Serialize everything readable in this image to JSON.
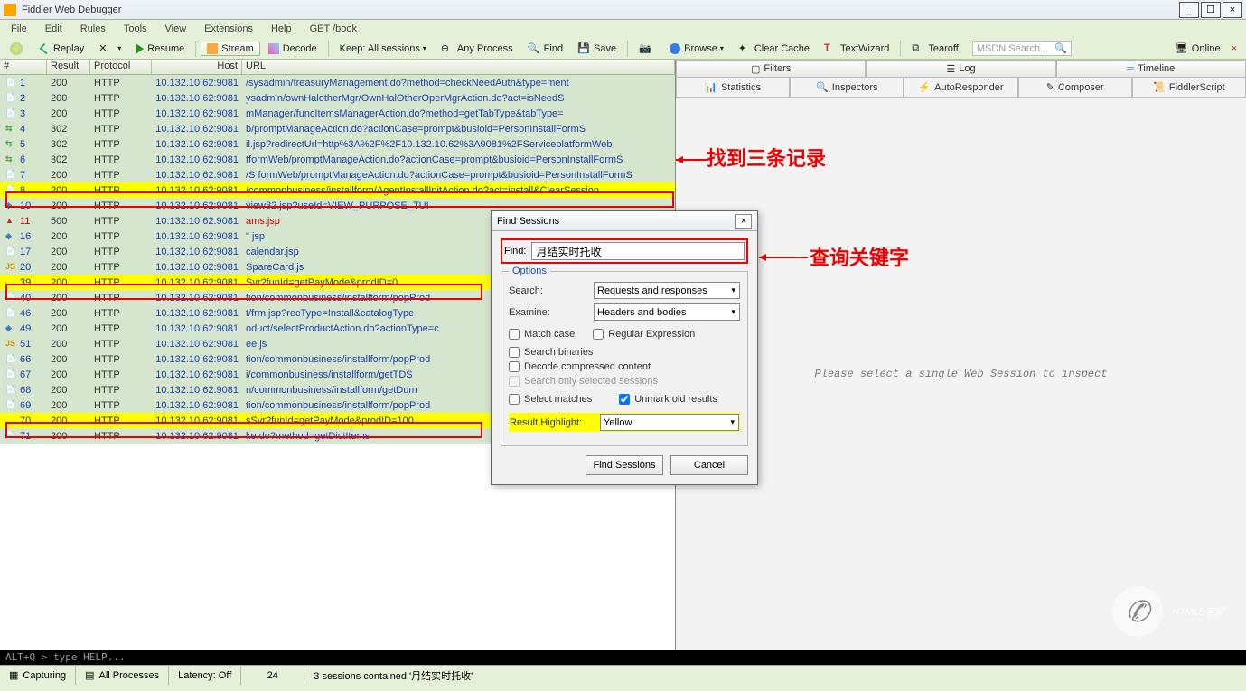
{
  "app": {
    "title": "Fiddler Web Debugger"
  },
  "menu": [
    "File",
    "Edit",
    "Rules",
    "Tools",
    "View",
    "Extensions",
    "Help",
    "GET /book"
  ],
  "toolbar": {
    "replay": "Replay",
    "resume": "Resume",
    "stream": "Stream",
    "decode": "Decode",
    "keep": "Keep: All sessions",
    "anyprocess": "Any Process",
    "find": "Find",
    "save": "Save",
    "browse": "Browse",
    "clearcache": "Clear Cache",
    "textwizard": "TextWizard",
    "tearoff": "Tearoff",
    "search_placeholder": "MSDN Search...",
    "online": "Online"
  },
  "columns": {
    "num": "#",
    "result": "Result",
    "protocol": "Protocol",
    "host": "Host",
    "url": "URL"
  },
  "sessions": [
    {
      "n": "1",
      "res": "200",
      "proto": "HTTP",
      "host": "10.132.10.62:9081",
      "url": "/sysadmin/treasuryManagement.do?method=checkNeedAuth&type=ment",
      "ic": "doc",
      "cls": "normal"
    },
    {
      "n": "2",
      "res": "200",
      "proto": "HTTP",
      "host": "10.132.10.62:9081",
      "url": "ysadmin/ownHalotherMgr/OwnHalOtherOperMgrAction.do?act=isNeedS",
      "ic": "doc",
      "cls": "normal"
    },
    {
      "n": "3",
      "res": "200",
      "proto": "HTTP",
      "host": "10.132.10.62:9081",
      "url": "mManager/funcItemsManagerAction.do?method=getTabType&tabType=",
      "ic": "doc",
      "cls": "normal"
    },
    {
      "n": "4",
      "res": "302",
      "proto": "HTTP",
      "host": "10.132.10.62:9081",
      "url": "b/promptManageAction.do?actionCase=prompt&busioid=PersonInstallFormS",
      "ic": "redir",
      "cls": "normal"
    },
    {
      "n": "5",
      "res": "302",
      "proto": "HTTP",
      "host": "10.132.10.62:9081",
      "url": "il.jsp?redirectUrl=http%3A%2F%2F10.132.10.62%3A9081%2FServiceplatformWeb",
      "ic": "redir",
      "cls": "normal"
    },
    {
      "n": "6",
      "res": "302",
      "proto": "HTTP",
      "host": "10.132.10.62:9081",
      "url": "tformWeb/promptManageAction.do?actionCase=prompt&busioid=PersonInstallFormS",
      "ic": "redir",
      "cls": "normal"
    },
    {
      "n": "7",
      "res": "200",
      "proto": "HTTP",
      "host": "10.132.10.62:9081",
      "url": "/S       formWeb/promptManageAction.do?actionCase=prompt&busioid=PersonInstallFormS",
      "ic": "doc",
      "cls": "normal"
    },
    {
      "n": "8",
      "res": "200",
      "proto": "HTTP",
      "host": "10.132.10.62:9081",
      "url": "/commonbusiness/installform/AgentInstallInitAction.do?act=install&ClearSession",
      "ic": "doc",
      "cls": "yellow"
    },
    {
      "n": "10",
      "res": "200",
      "proto": "HTTP",
      "host": "10.132.10.62:9081",
      "url": "view32.jsp?useId=VIEW_PURPOSE_TUI",
      "ic": "diamond",
      "cls": "normal"
    },
    {
      "n": "11",
      "res": "500",
      "proto": "HTTP",
      "host": "10.132.10.62:9081",
      "url": "ams.jsp",
      "ic": "warn",
      "cls": "normal red500"
    },
    {
      "n": "16",
      "res": "200",
      "proto": "HTTP",
      "host": "10.132.10.62:9081",
      "url": "\" jsp",
      "ic": "diamond",
      "cls": "normal"
    },
    {
      "n": "17",
      "res": "200",
      "proto": "HTTP",
      "host": "10.132.10.62:9081",
      "url": "calendar.jsp",
      "ic": "doc",
      "cls": "normal"
    },
    {
      "n": "20",
      "res": "200",
      "proto": "HTTP",
      "host": "10.132.10.62:9081",
      "url": "SpareCard.js",
      "ic": "js",
      "cls": "normal"
    },
    {
      "n": "39",
      "res": "200",
      "proto": "HTTP",
      "host": "10.132.10.62:9081",
      "url": "Svr?funId=getPayMode&prodID=0",
      "ic": "xml",
      "cls": "yellow"
    },
    {
      "n": "40",
      "res": "200",
      "proto": "HTTP",
      "host": "10.132.10.62:9081",
      "url": "tion/commonbusiness/installform/popProd",
      "ic": "doc",
      "cls": "normal"
    },
    {
      "n": "46",
      "res": "200",
      "proto": "HTTP",
      "host": "10.132.10.62:9081",
      "url": "t/frm.jsp?recType=Install&catalogType",
      "ic": "doc",
      "cls": "normal"
    },
    {
      "n": "49",
      "res": "200",
      "proto": "HTTP",
      "host": "10.132.10.62:9081",
      "url": "oduct/selectProductAction.do?actionType=c",
      "ic": "diamond",
      "cls": "normal"
    },
    {
      "n": "51",
      "res": "200",
      "proto": "HTTP",
      "host": "10.132.10.62:9081",
      "url": "ee.js",
      "ic": "js",
      "cls": "normal"
    },
    {
      "n": "66",
      "res": "200",
      "proto": "HTTP",
      "host": "10.132.10.62:9081",
      "url": "tion/commonbusiness/installform/popProd",
      "ic": "doc",
      "cls": "normal"
    },
    {
      "n": "67",
      "res": "200",
      "proto": "HTTP",
      "host": "10.132.10.62:9081",
      "url": "i/commonbusiness/installform/getTDS",
      "ic": "doc",
      "cls": "normal"
    },
    {
      "n": "68",
      "res": "200",
      "proto": "HTTP",
      "host": "10.132.10.62:9081",
      "url": "n/commonbusiness/installform/getDum",
      "ic": "doc",
      "cls": "normal"
    },
    {
      "n": "69",
      "res": "200",
      "proto": "HTTP",
      "host": "10.132.10.62:9081",
      "url": "tion/commonbusiness/installform/popProd",
      "ic": "doc",
      "cls": "normal"
    },
    {
      "n": "70",
      "res": "200",
      "proto": "HTTP",
      "host": "10.132.10.62:9081",
      "url": "sSvr?funId=getPayMode&prodID=100",
      "ic": "xml",
      "cls": "yellow"
    },
    {
      "n": "71",
      "res": "200",
      "proto": "HTTP",
      "host": "10.132.10.62:9081",
      "url": "ke.do?method=getDictItems",
      "ic": "doc",
      "cls": "normal"
    }
  ],
  "right_tabs1": {
    "filters": "Filters",
    "log": "Log",
    "timeline": "Timeline"
  },
  "right_tabs2": {
    "statistics": "Statistics",
    "inspectors": "Inspectors",
    "autoresponder": "AutoResponder",
    "composer": "Composer",
    "fiddlerscript": "FiddlerScript"
  },
  "inspect_msg": "Please select a single Web Session to inspect",
  "altq": "ALT+Q > type HELP...",
  "status": {
    "capturing": "Capturing",
    "allproc": "All Processes",
    "latency": "Latency: Off",
    "count": "24",
    "msg": "3 sessions contained '月结实时托收'"
  },
  "dialog": {
    "title": "Find Sessions",
    "find_label": "Find:",
    "find_value": "月结实时托收",
    "options": "Options",
    "search": "Search:",
    "search_val": "Requests and responses",
    "examine": "Examine:",
    "examine_val": "Headers and bodies",
    "matchcase": "Match case",
    "regex": "Regular Expression",
    "searchbin": "Search binaries",
    "decode": "Decode compressed content",
    "searchonly": "Search only selected sessions",
    "selectmatches": "Select matches",
    "unmark": "Unmark old results",
    "resulthl": "Result Highlight:",
    "resulthl_val": "Yellow",
    "btn_find": "Find Sessions",
    "btn_cancel": "Cancel"
  },
  "annotations": {
    "found": "找到三条记录",
    "keyword": "查询关键字"
  },
  "watermark": "HTML5学堂"
}
